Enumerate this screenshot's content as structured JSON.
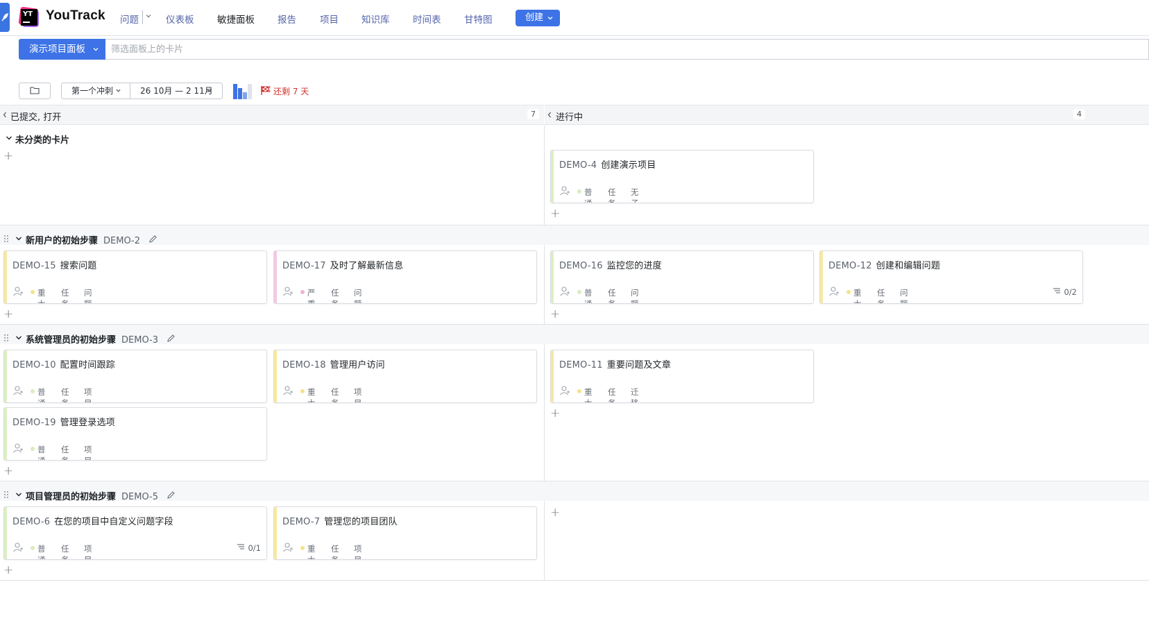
{
  "header": {
    "brand": "YouTrack",
    "nav": [
      {
        "label": "问题"
      },
      {
        "label": "仪表板"
      },
      {
        "label": "敏捷面板"
      },
      {
        "label": "报告"
      },
      {
        "label": "项目"
      },
      {
        "label": "知识库"
      },
      {
        "label": "时间表"
      },
      {
        "label": "甘特图"
      }
    ],
    "create_label": "创建"
  },
  "board": {
    "name": "演示项目面板",
    "filter_placeholder": "筛选面板上的卡片"
  },
  "toolbar": {
    "sprint": "第一个冲刺",
    "dates": "26 10月 — 2 11月",
    "days_left": "还剩 7 天"
  },
  "columns": [
    {
      "title": "已提交, 打开",
      "count": "7"
    },
    {
      "title": "进行中",
      "count": "4"
    }
  ],
  "colors": {
    "accent": "#3d73e6",
    "stripe_normal": "#dcefc4",
    "stripe_major": "#f7e8a0",
    "stripe_critical": "#f4c8e3",
    "dot_normal": "#d9ecc0",
    "dot_major": "#f5e28b",
    "dot_critical": "#f0b3d5",
    "days_left": "#d0352f"
  },
  "lanes": [
    {
      "title": "未分类的卡片",
      "cards": [
        {
          "id": "DEMO-4",
          "title": "创建演示项目",
          "priority": "普通",
          "type": "任务",
          "subsystem": "无子系统"
        }
      ]
    },
    {
      "title": "新用户的初始步骤",
      "id": "DEMO-2",
      "cards": [
        {
          "id": "DEMO-15",
          "title": "搜索问题",
          "priority": "重大",
          "type": "任务",
          "subsystem": "问题跟踪"
        },
        {
          "id": "DEMO-17",
          "title": "及时了解最新信息",
          "priority": "严重",
          "type": "任务",
          "subsystem": "问题跟踪"
        },
        {
          "id": "DEMO-16",
          "title": "监控您的进度",
          "priority": "普通",
          "type": "任务",
          "subsystem": "问题跟踪"
        },
        {
          "id": "DEMO-12",
          "title": "创建和编辑问题",
          "priority": "重大",
          "type": "任务",
          "subsystem": "问题跟踪",
          "checklist": "0/2"
        }
      ]
    },
    {
      "title": "系统管理员的初始步骤",
      "id": "DEMO-3",
      "cards": [
        {
          "id": "DEMO-10",
          "title": "配置时间跟踪",
          "priority": "普通",
          "type": "任务",
          "subsystem": "项目管理"
        },
        {
          "id": "DEMO-18",
          "title": "管理用户访问",
          "priority": "重大",
          "type": "任务",
          "subsystem": "项目管理"
        },
        {
          "id": "DEMO-11",
          "title": "重要问题及文章",
          "priority": "重大",
          "type": "任务",
          "subsystem": "迁移"
        },
        {
          "id": "DEMO-19",
          "title": "管理登录选项",
          "priority": "普通",
          "type": "任务",
          "subsystem": "项目管理"
        }
      ]
    },
    {
      "title": "项目管理员的初始步骤",
      "id": "DEMO-5",
      "cards": [
        {
          "id": "DEMO-6",
          "title": "在您的项目中自定义问题字段",
          "priority": "普通",
          "type": "任务",
          "subsystem": "项目管理",
          "checklist": "0/1"
        },
        {
          "id": "DEMO-7",
          "title": "管理您的项目团队",
          "priority": "重大",
          "type": "任务",
          "subsystem": "项目管理"
        }
      ]
    }
  ]
}
